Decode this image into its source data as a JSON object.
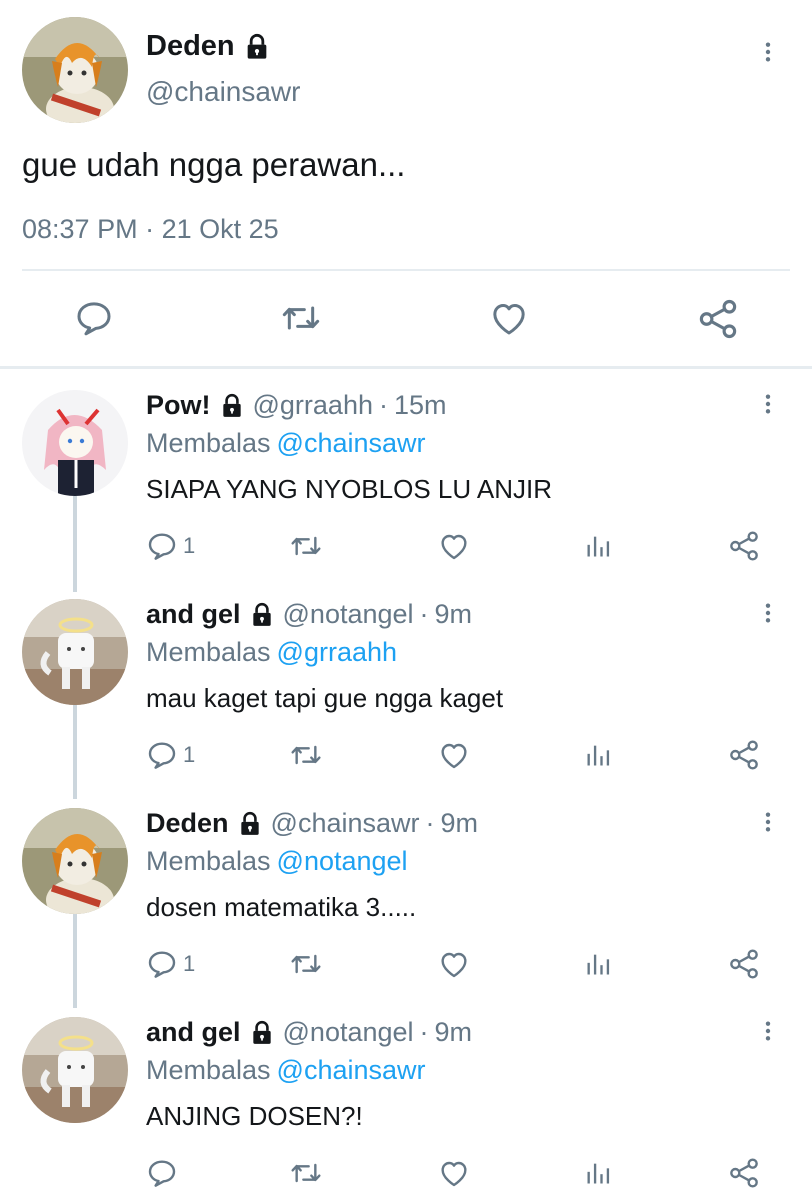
{
  "main_tweet": {
    "display_name": "Deden",
    "handle": "@chainsawr",
    "text": "gue udah ngga perawan...",
    "time": "08:37 PM",
    "separator": "·",
    "date": "21 Okt 25",
    "avatar": "cat-with-orange-wig-avatar"
  },
  "replies": [
    {
      "display_name": "Pow!",
      "handle": "@grraahh",
      "separator": "·",
      "time": "15m",
      "replying_prefix": "Membalas",
      "replying_to": "@chainsawr",
      "text": "SIAPA YANG NYOBLOS LU ANJIR",
      "reply_count": "1",
      "avatar": "pink-hair-anime-cat-avatar"
    },
    {
      "display_name": "and gel",
      "handle": "@notangel",
      "separator": "·",
      "time": "9m",
      "replying_prefix": "Membalas",
      "replying_to": "@grraahh",
      "text": "mau kaget tapi gue ngga kaget",
      "reply_count": "1",
      "avatar": "white-cat-halo-avatar"
    },
    {
      "display_name": "Deden",
      "handle": "@chainsawr",
      "separator": "·",
      "time": "9m",
      "replying_prefix": "Membalas",
      "replying_to": "@notangel",
      "text": "dosen matematika 3.....",
      "reply_count": "1",
      "avatar": "cat-with-orange-wig-avatar"
    },
    {
      "display_name": "and gel",
      "handle": "@notangel",
      "separator": "·",
      "time": "9m",
      "replying_prefix": "Membalas",
      "replying_to": "@chainsawr",
      "text": "ANJING DOSEN?!",
      "reply_count": "",
      "avatar": "white-cat-halo-avatar"
    }
  ],
  "colors": {
    "text": "#14171a",
    "secondary": "#657786",
    "link": "#1da1f2",
    "divider": "#e6ecf0",
    "thread_line": "#ccd6dd"
  },
  "icons": [
    "lock-icon",
    "more-vertical-icon",
    "reply-icon",
    "retweet-icon",
    "like-icon",
    "analytics-icon",
    "share-icon"
  ]
}
